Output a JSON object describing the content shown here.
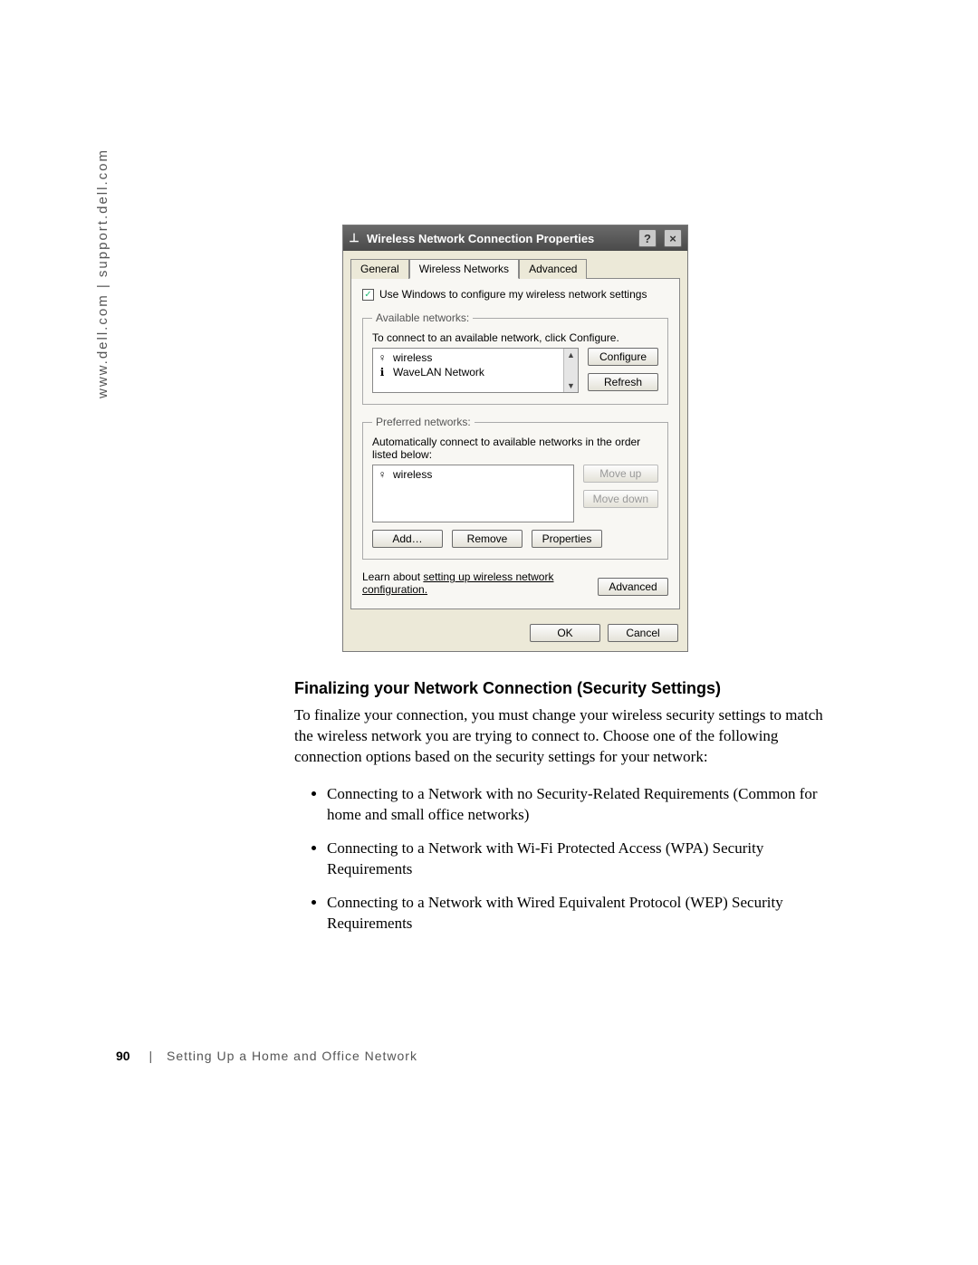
{
  "sidetext": "www.dell.com | support.dell.com",
  "dialog": {
    "title": "Wireless Network Connection Properties",
    "help_glyph": "?",
    "close_glyph": "×",
    "tabs": {
      "general": "General",
      "wireless": "Wireless Networks",
      "advanced": "Advanced"
    },
    "use_windows": "Use Windows to configure my wireless network settings",
    "available": {
      "legend": "Available networks:",
      "hint": "To connect to an available network, click Configure.",
      "items": [
        "wireless",
        "WaveLAN Network"
      ],
      "configure": "Configure",
      "refresh": "Refresh"
    },
    "preferred": {
      "legend": "Preferred networks:",
      "hint": "Automatically connect to available networks in the order listed below:",
      "items": [
        "wireless"
      ],
      "moveup": "Move up",
      "movedown": "Move down",
      "add": "Add…",
      "remove": "Remove",
      "properties": "Properties"
    },
    "learn_prefix": "Learn about ",
    "learn_link": "setting up wireless network configuration.",
    "advanced_btn": "Advanced",
    "ok": "OK",
    "cancel": "Cancel"
  },
  "section": {
    "heading": "Finalizing your Network Connection (Security Settings)",
    "para": "To finalize your connection, you must change your wireless security settings to match the wireless network you are trying to connect to. Choose one of the following connection options based on the security settings for your network:",
    "bullets": [
      "Connecting to a Network with no Security-Related Requirements (Common for home and small office networks)",
      "Connecting to a Network with Wi-Fi Protected Access (WPA) Security Requirements",
      "Connecting to a Network with Wired Equivalent Protocol (WEP) Security Requirements"
    ]
  },
  "footer": {
    "page": "90",
    "chapter": "Setting Up a Home and Office Network"
  }
}
